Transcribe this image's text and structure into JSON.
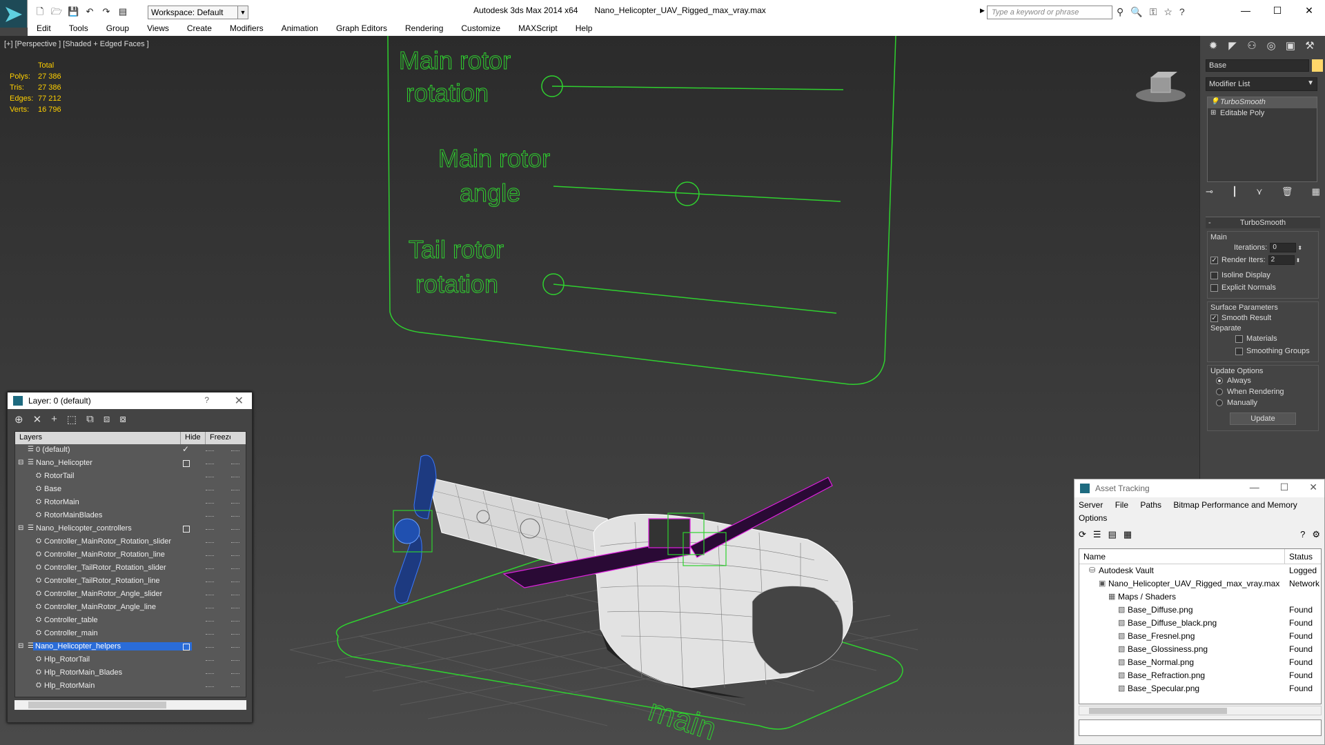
{
  "titlebar": {
    "workspace": "Workspace: Default",
    "app_title": "Autodesk 3ds Max  2014 x64",
    "file_name": "Nano_Helicopter_UAV_Rigged_max_vray.max",
    "search_placeholder": "Type a keyword or phrase"
  },
  "menu": [
    "Edit",
    "Tools",
    "Group",
    "Views",
    "Create",
    "Modifiers",
    "Animation",
    "Graph Editors",
    "Rendering",
    "Customize",
    "MAXScript",
    "Help"
  ],
  "viewport": {
    "label": "[+] [Perspective ] [Shaded + Edged Faces ]",
    "stats_header": "Total",
    "stats": [
      {
        "k": "Polys:",
        "v": "27 386"
      },
      {
        "k": "Tris:",
        "v": "27 386"
      },
      {
        "k": "Edges:",
        "v": "77 212"
      },
      {
        "k": "Verts:",
        "v": "16 796"
      }
    ],
    "controllers": {
      "main_rotor_rotation_1": "Main rotor",
      "main_rotor_rotation_2": "rotation",
      "main_rotor_angle_1": "Main rotor",
      "main_rotor_angle_2": "angle",
      "tail_rotor_rotation_1": "Tail rotor",
      "tail_rotor_rotation_2": "rotation",
      "ground_label": "main"
    }
  },
  "command_panel": {
    "object_name": "Base",
    "modifier_list": "Modifier List",
    "stack": [
      "TurboSmooth",
      "Editable Poly"
    ],
    "rollout_title": "TurboSmooth",
    "main_group": "Main",
    "iterations_label": "Iterations:",
    "iterations_value": "0",
    "render_iters_label": "Render Iters:",
    "render_iters_value": "2",
    "isoline_label": "Isoline Display",
    "explicit_normals_label": "Explicit Normals",
    "surface_group": "Surface Parameters",
    "smooth_result_label": "Smooth Result",
    "separate_label": "Separate",
    "materials_label": "Materials",
    "smoothing_groups_label": "Smoothing Groups",
    "update_group": "Update Options",
    "always_label": "Always",
    "when_rendering_label": "When Rendering",
    "manually_label": "Manually",
    "update_button": "Update"
  },
  "layer_window": {
    "title": "Layer: 0 (default)",
    "help": "?",
    "col_layers": "Layers",
    "col_hide": "Hide",
    "col_freeze": "Freeze",
    "rows": [
      {
        "name": "0 (default)",
        "level": 1,
        "type": "layer",
        "current": true
      },
      {
        "name": "Nano_Helicopter",
        "level": 0,
        "type": "layer"
      },
      {
        "name": "RotorTail",
        "level": 2,
        "type": "obj"
      },
      {
        "name": "Base",
        "level": 2,
        "type": "obj"
      },
      {
        "name": "RotorMain",
        "level": 2,
        "type": "obj"
      },
      {
        "name": "RotorMainBlades",
        "level": 2,
        "type": "obj"
      },
      {
        "name": "Nano_Helicopter_controllers",
        "level": 0,
        "type": "layer"
      },
      {
        "name": "Controller_MainRotor_Rotation_slider",
        "level": 2,
        "type": "obj"
      },
      {
        "name": "Controller_MainRotor_Rotation_line",
        "level": 2,
        "type": "obj"
      },
      {
        "name": "Controller_TailRotor_Rotation_slider",
        "level": 2,
        "type": "obj"
      },
      {
        "name": "Controller_TailRotor_Rotation_line",
        "level": 2,
        "type": "obj"
      },
      {
        "name": "Controller_MainRotor_Angle_slider",
        "level": 2,
        "type": "obj"
      },
      {
        "name": "Controller_MainRotor_Angle_line",
        "level": 2,
        "type": "obj"
      },
      {
        "name": "Controller_table",
        "level": 2,
        "type": "obj"
      },
      {
        "name": "Controller_main",
        "level": 2,
        "type": "obj"
      },
      {
        "name": "Nano_Helicopter_helpers",
        "level": 0,
        "type": "layer",
        "selected": true
      },
      {
        "name": "Hlp_RotorTail",
        "level": 2,
        "type": "obj"
      },
      {
        "name": "Hlp_RotorMain_Blades",
        "level": 2,
        "type": "obj"
      },
      {
        "name": "Hlp_RotorMain",
        "level": 2,
        "type": "obj"
      }
    ]
  },
  "asset_window": {
    "title": "Asset Tracking",
    "menu": [
      "Server",
      "File",
      "Paths",
      "Bitmap Performance and Memory"
    ],
    "menu2": "Options",
    "col_name": "Name",
    "col_status": "Status",
    "rows": [
      {
        "name": "Autodesk Vault",
        "status": "Logged",
        "level": 1
      },
      {
        "name": "Nano_Helicopter_UAV_Rigged_max_vray.max",
        "status": "Network",
        "level": 2
      },
      {
        "name": "Maps / Shaders",
        "status": "",
        "level": 3
      },
      {
        "name": "Base_Diffuse.png",
        "status": "Found",
        "level": 4
      },
      {
        "name": "Base_Diffuse_black.png",
        "status": "Found",
        "level": 4
      },
      {
        "name": "Base_Fresnel.png",
        "status": "Found",
        "level": 4
      },
      {
        "name": "Base_Glossiness.png",
        "status": "Found",
        "level": 4
      },
      {
        "name": "Base_Normal.png",
        "status": "Found",
        "level": 4
      },
      {
        "name": "Base_Refraction.png",
        "status": "Found",
        "level": 4
      },
      {
        "name": "Base_Specular.png",
        "status": "Found",
        "level": 4
      }
    ]
  },
  "colors": {
    "controller_green": "#2fd12f",
    "selection_magenta": "#e020e0",
    "tail_blue": "#2060ff",
    "stats_yellow": "#ffd000"
  }
}
